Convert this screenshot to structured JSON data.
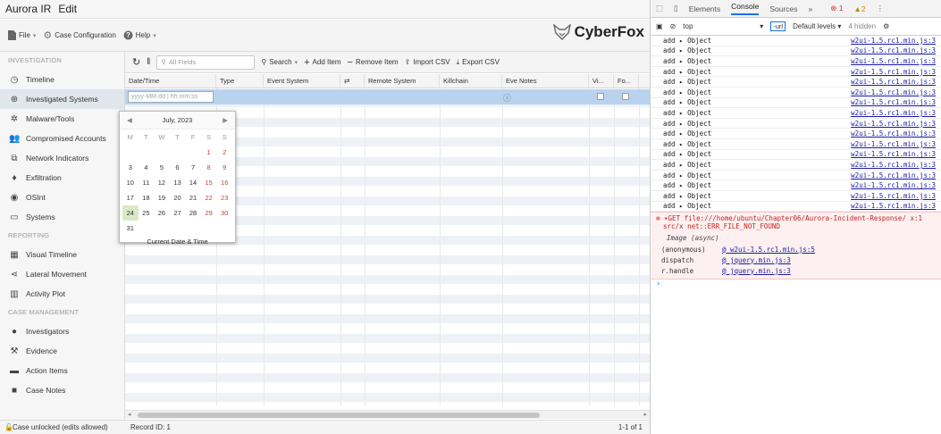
{
  "app": {
    "title": "Aurora IR",
    "menu_edit": "Edit"
  },
  "toolbar": {
    "file": "File",
    "case_config": "Case Configuration",
    "help": "Help",
    "logo": "CyberFox"
  },
  "sidebar": {
    "sections": [
      {
        "header": "INVESTIGATION",
        "items": [
          "Timeline",
          "Investigated Systems",
          "Malware/Tools",
          "Compromised Accounts",
          "Network Indicators",
          "Exfiltration",
          "OSInt",
          "Systems"
        ]
      },
      {
        "header": "REPORTING",
        "items": [
          "Visual Timeline",
          "Lateral Movement",
          "Activity Plot"
        ]
      },
      {
        "header": "CASE MANAGEMENT",
        "items": [
          "Investigators",
          "Evidence",
          "Action Items",
          "Case Notes"
        ]
      }
    ],
    "selected": "Investigated Systems"
  },
  "grid": {
    "search_placeholder": "All Fields",
    "search": "Search",
    "add": "Add Item",
    "remove": "Remove Item",
    "import": "Import CSV",
    "export": "Export CSV",
    "columns": [
      "Date/Time",
      "Type",
      "Event System",
      "⇄",
      "Remote System",
      "Killchain",
      "Eve Notes",
      "Vi...",
      "Fo..."
    ],
    "date_placeholder": "yyyy-MM-dd | hh:mm:ss",
    "record_id": "Record ID: 1",
    "paging": "1-1 of 1"
  },
  "calendar": {
    "month": "July, 2023",
    "weekdays": [
      "M",
      "T",
      "W",
      "T",
      "F",
      "S",
      "S"
    ],
    "weeks": [
      [
        "",
        "",
        "",
        "",
        "",
        "1",
        "2"
      ],
      [
        "3",
        "4",
        "5",
        "6",
        "7",
        "8",
        "9"
      ],
      [
        "10",
        "11",
        "12",
        "13",
        "14",
        "15",
        "16"
      ],
      [
        "17",
        "18",
        "19",
        "20",
        "21",
        "22",
        "23"
      ],
      [
        "24",
        "25",
        "26",
        "27",
        "28",
        "29",
        "30"
      ],
      [
        "31",
        "",
        "",
        "",
        "",
        "",
        ""
      ]
    ],
    "today": "24",
    "footer": "Current Date & Time"
  },
  "footer": {
    "status": "Case unlocked (edits allowed)"
  },
  "devtools": {
    "tabs": [
      "Elements",
      "Console",
      "Sources",
      "»"
    ],
    "errors": "1",
    "warnings": "2",
    "context": "top",
    "filter_value": "-url",
    "levels": "Default levels ▾",
    "hidden": "4 hidden",
    "log_rows": [
      {
        "msg": "add ▸ Object",
        "src": "w2ui-1.5.rc1.min.js:3"
      },
      {
        "msg": "add ▸ Object",
        "src": "w2ui-1.5.rc1.min.js:3"
      },
      {
        "msg": "add ▸ Object",
        "src": "w2ui-1.5.rc1.min.js:3"
      },
      {
        "msg": "add ▸ Object",
        "src": "w2ui-1.5.rc1.min.js:3"
      },
      {
        "msg": "add ▸ Object",
        "src": "w2ui-1.5.rc1.min.js:3"
      },
      {
        "msg": "add ▸ Object",
        "src": "w2ui-1.5.rc1.min.js:3"
      },
      {
        "msg": "add ▸ Object",
        "src": "w2ui-1.5.rc1.min.js:3"
      },
      {
        "msg": "add ▸ Object",
        "src": "w2ui-1.5.rc1.min.js:3"
      },
      {
        "msg": "add ▸ Object",
        "src": "w2ui-1.5.rc1.min.js:3"
      },
      {
        "msg": "add ▸ Object",
        "src": "w2ui-1.5.rc1.min.js:3"
      },
      {
        "msg": "add ▸ Object",
        "src": "w2ui-1.5.rc1.min.js:3"
      },
      {
        "msg": "add ▸ Object",
        "src": "w2ui-1.5.rc1.min.js:3"
      },
      {
        "msg": "add ▸ Object",
        "src": "w2ui-1.5.rc1.min.js:3"
      },
      {
        "msg": "add ▸ Object",
        "src": "w2ui-1.5.rc1.min.js:3"
      },
      {
        "msg": "add ▸ Object",
        "src": "w2ui-1.5.rc1.min.js:3"
      },
      {
        "msg": "add ▸ Object",
        "src": "w2ui-1.5.rc1.min.js:3"
      },
      {
        "msg": "add ▸ Object",
        "src": "w2ui-1.5.rc1.min.js:3"
      }
    ],
    "error": {
      "line1": "▾GET file:///home/ubuntu/Chapter06/Aurora-Incident-Response/ x:1",
      "line2": "src/x net::ERR_FILE_NOT_FOUND",
      "async": "Image (async)",
      "stack": [
        {
          "fn": "(anonymous)",
          "src": "@ w2ui-1.5.rc1.min.js:5"
        },
        {
          "fn": "dispatch",
          "src": "@ jquery.min.js:3"
        },
        {
          "fn": "r.handle",
          "src": "@ jquery.min.js:3"
        }
      ]
    },
    "prompt": "›"
  }
}
